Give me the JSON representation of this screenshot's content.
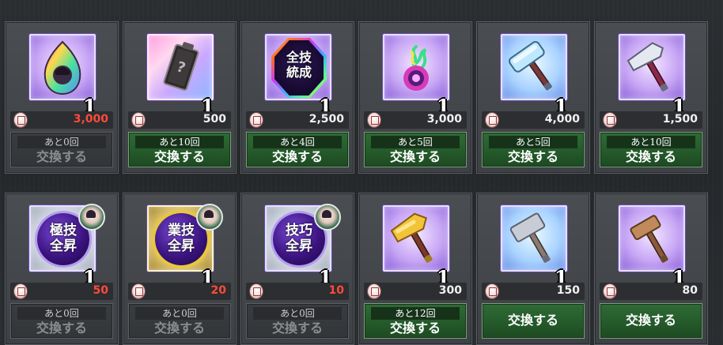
{
  "screen": "exchange-shop",
  "rows": [
    [
      {
        "icon": "rainbow-gem-icon",
        "qty": "1",
        "price": "3,000",
        "price_red": true,
        "remain": "あと0回",
        "button": "交換する",
        "disabled": true
      },
      {
        "icon": "mystery-tablet-icon",
        "qty": "1",
        "price": "500",
        "price_red": false,
        "remain": "あと10回",
        "button": "交換する",
        "disabled": false
      },
      {
        "icon": "all-skills-emblem-icon",
        "emblem_text": "全技統成",
        "qty": "1",
        "price": "2,500",
        "price_red": false,
        "remain": "あと4回",
        "button": "交換する",
        "disabled": false
      },
      {
        "icon": "spirit-flame-orb-icon",
        "qty": "1",
        "price": "3,000",
        "price_red": false,
        "remain": "あと5回",
        "button": "交換する",
        "disabled": false
      },
      {
        "icon": "crystal-hammer-icon",
        "qty": "1",
        "price": "4,000",
        "price_red": false,
        "remain": "あと5回",
        "button": "交換する",
        "disabled": false
      },
      {
        "icon": "silver-hammer-icon",
        "qty": "1",
        "price": "1,500",
        "price_red": false,
        "remain": "あと10回",
        "button": "交換する",
        "disabled": false
      }
    ],
    [
      {
        "icon": "ultimate-skill-orb-icon",
        "orb_text": "極技全昇",
        "qty": "1",
        "price": "50",
        "price_red": true,
        "remain": "あと0回",
        "button": "交換する",
        "disabled": true
      },
      {
        "icon": "craft-skill-orb-icon",
        "orb_text": "業技全昇",
        "qty": "1",
        "price": "20",
        "price_red": true,
        "remain": "あと0回",
        "button": "交換する",
        "disabled": true
      },
      {
        "icon": "skilled-orb-icon",
        "orb_text": "技巧全昇",
        "qty": "1",
        "price": "10",
        "price_red": true,
        "remain": "あと0回",
        "button": "交換する",
        "disabled": true
      },
      {
        "icon": "gold-hammer-icon",
        "qty": "1",
        "price": "300",
        "price_red": false,
        "remain": "あと12回",
        "button": "交換する",
        "disabled": false
      },
      {
        "icon": "steel-hammer-icon",
        "qty": "1",
        "price": "150",
        "price_red": false,
        "remain": "",
        "button": "交換する",
        "disabled": false
      },
      {
        "icon": "wood-hammer-icon",
        "qty": "1",
        "price": "80",
        "price_red": false,
        "remain": "",
        "button": "交換する",
        "disabled": false
      }
    ]
  ]
}
